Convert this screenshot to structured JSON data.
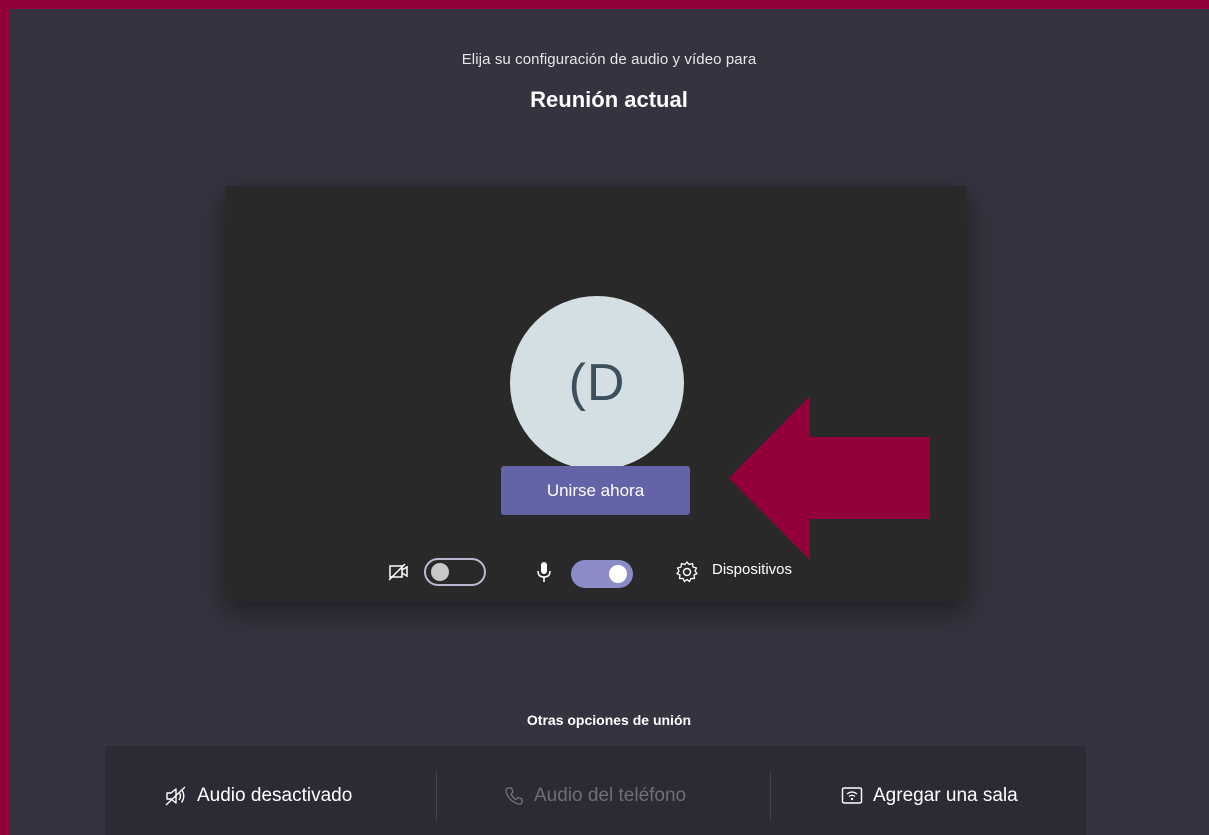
{
  "header": {
    "subtitle": "Elija su configuración de audio y vídeo para",
    "title": "Reunión actual"
  },
  "preview": {
    "avatar_initials": "(D",
    "join_button_label": "Unirse ahora",
    "camera_toggle": {
      "state": "off",
      "icon": "camera-off-icon"
    },
    "mic_toggle": {
      "state": "on",
      "icon": "microphone-icon"
    },
    "devices_label": "Dispositivos",
    "devices_icon": "gear-icon"
  },
  "annotation": {
    "arrow_color": "#94003a",
    "points_to": "join-button"
  },
  "other_options": {
    "heading": "Otras opciones de unión",
    "items": [
      {
        "label": "Audio desactivado",
        "icon": "speaker-off-icon",
        "enabled": true
      },
      {
        "label": "Audio del teléfono",
        "icon": "phone-icon",
        "enabled": false
      },
      {
        "label": "Agregar una sala",
        "icon": "room-cast-icon",
        "enabled": true
      }
    ]
  },
  "colors": {
    "frame_border": "#94003a",
    "background": "#35333f",
    "preview_bg": "#292929",
    "accent": "#6264a7",
    "toggle_on": "#8b8cc7",
    "avatar_bg": "#d4dfe4"
  }
}
